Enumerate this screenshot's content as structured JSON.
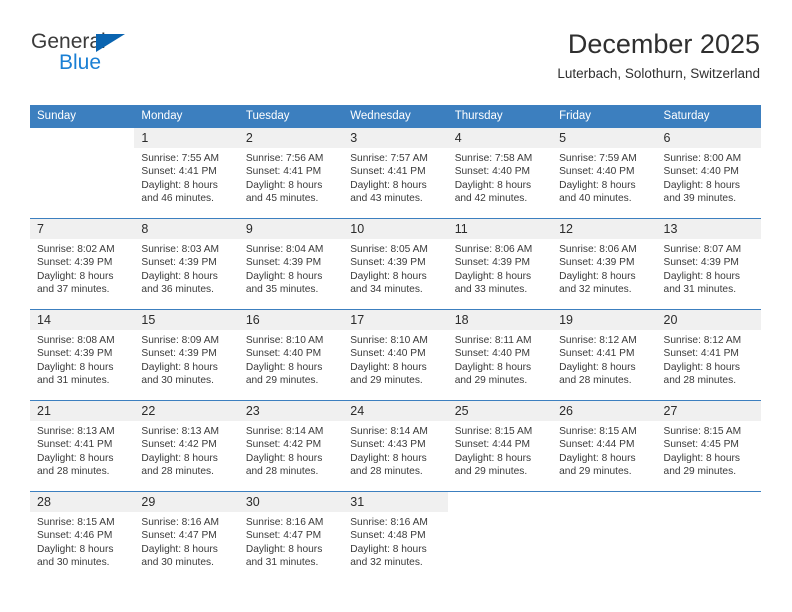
{
  "brand": {
    "name_top": "General",
    "name_bottom": "Blue",
    "triangle_color": "#0a64b0",
    "blue_color": "#1a7fd4"
  },
  "header": {
    "title": "December 2025",
    "subtitle": "Luterbach, Solothurn, Switzerland"
  },
  "theme": {
    "header_row_bg": "#3c7fbf",
    "header_row_text": "#ffffff",
    "daynum_bg": "#f0f0f0",
    "grid_line": "#3c7fbf"
  },
  "weekday_headers": [
    "Sunday",
    "Monday",
    "Tuesday",
    "Wednesday",
    "Thursday",
    "Friday",
    "Saturday"
  ],
  "weeks": [
    [
      {
        "day": "",
        "sunrise": "",
        "sunset": "",
        "daylight1": "",
        "daylight2": ""
      },
      {
        "day": "1",
        "sunrise": "Sunrise: 7:55 AM",
        "sunset": "Sunset: 4:41 PM",
        "daylight1": "Daylight: 8 hours",
        "daylight2": "and 46 minutes."
      },
      {
        "day": "2",
        "sunrise": "Sunrise: 7:56 AM",
        "sunset": "Sunset: 4:41 PM",
        "daylight1": "Daylight: 8 hours",
        "daylight2": "and 45 minutes."
      },
      {
        "day": "3",
        "sunrise": "Sunrise: 7:57 AM",
        "sunset": "Sunset: 4:41 PM",
        "daylight1": "Daylight: 8 hours",
        "daylight2": "and 43 minutes."
      },
      {
        "day": "4",
        "sunrise": "Sunrise: 7:58 AM",
        "sunset": "Sunset: 4:40 PM",
        "daylight1": "Daylight: 8 hours",
        "daylight2": "and 42 minutes."
      },
      {
        "day": "5",
        "sunrise": "Sunrise: 7:59 AM",
        "sunset": "Sunset: 4:40 PM",
        "daylight1": "Daylight: 8 hours",
        "daylight2": "and 40 minutes."
      },
      {
        "day": "6",
        "sunrise": "Sunrise: 8:00 AM",
        "sunset": "Sunset: 4:40 PM",
        "daylight1": "Daylight: 8 hours",
        "daylight2": "and 39 minutes."
      }
    ],
    [
      {
        "day": "7",
        "sunrise": "Sunrise: 8:02 AM",
        "sunset": "Sunset: 4:39 PM",
        "daylight1": "Daylight: 8 hours",
        "daylight2": "and 37 minutes."
      },
      {
        "day": "8",
        "sunrise": "Sunrise: 8:03 AM",
        "sunset": "Sunset: 4:39 PM",
        "daylight1": "Daylight: 8 hours",
        "daylight2": "and 36 minutes."
      },
      {
        "day": "9",
        "sunrise": "Sunrise: 8:04 AM",
        "sunset": "Sunset: 4:39 PM",
        "daylight1": "Daylight: 8 hours",
        "daylight2": "and 35 minutes."
      },
      {
        "day": "10",
        "sunrise": "Sunrise: 8:05 AM",
        "sunset": "Sunset: 4:39 PM",
        "daylight1": "Daylight: 8 hours",
        "daylight2": "and 34 minutes."
      },
      {
        "day": "11",
        "sunrise": "Sunrise: 8:06 AM",
        "sunset": "Sunset: 4:39 PM",
        "daylight1": "Daylight: 8 hours",
        "daylight2": "and 33 minutes."
      },
      {
        "day": "12",
        "sunrise": "Sunrise: 8:06 AM",
        "sunset": "Sunset: 4:39 PM",
        "daylight1": "Daylight: 8 hours",
        "daylight2": "and 32 minutes."
      },
      {
        "day": "13",
        "sunrise": "Sunrise: 8:07 AM",
        "sunset": "Sunset: 4:39 PM",
        "daylight1": "Daylight: 8 hours",
        "daylight2": "and 31 minutes."
      }
    ],
    [
      {
        "day": "14",
        "sunrise": "Sunrise: 8:08 AM",
        "sunset": "Sunset: 4:39 PM",
        "daylight1": "Daylight: 8 hours",
        "daylight2": "and 31 minutes."
      },
      {
        "day": "15",
        "sunrise": "Sunrise: 8:09 AM",
        "sunset": "Sunset: 4:39 PM",
        "daylight1": "Daylight: 8 hours",
        "daylight2": "and 30 minutes."
      },
      {
        "day": "16",
        "sunrise": "Sunrise: 8:10 AM",
        "sunset": "Sunset: 4:40 PM",
        "daylight1": "Daylight: 8 hours",
        "daylight2": "and 29 minutes."
      },
      {
        "day": "17",
        "sunrise": "Sunrise: 8:10 AM",
        "sunset": "Sunset: 4:40 PM",
        "daylight1": "Daylight: 8 hours",
        "daylight2": "and 29 minutes."
      },
      {
        "day": "18",
        "sunrise": "Sunrise: 8:11 AM",
        "sunset": "Sunset: 4:40 PM",
        "daylight1": "Daylight: 8 hours",
        "daylight2": "and 29 minutes."
      },
      {
        "day": "19",
        "sunrise": "Sunrise: 8:12 AM",
        "sunset": "Sunset: 4:41 PM",
        "daylight1": "Daylight: 8 hours",
        "daylight2": "and 28 minutes."
      },
      {
        "day": "20",
        "sunrise": "Sunrise: 8:12 AM",
        "sunset": "Sunset: 4:41 PM",
        "daylight1": "Daylight: 8 hours",
        "daylight2": "and 28 minutes."
      }
    ],
    [
      {
        "day": "21",
        "sunrise": "Sunrise: 8:13 AM",
        "sunset": "Sunset: 4:41 PM",
        "daylight1": "Daylight: 8 hours",
        "daylight2": "and 28 minutes."
      },
      {
        "day": "22",
        "sunrise": "Sunrise: 8:13 AM",
        "sunset": "Sunset: 4:42 PM",
        "daylight1": "Daylight: 8 hours",
        "daylight2": "and 28 minutes."
      },
      {
        "day": "23",
        "sunrise": "Sunrise: 8:14 AM",
        "sunset": "Sunset: 4:42 PM",
        "daylight1": "Daylight: 8 hours",
        "daylight2": "and 28 minutes."
      },
      {
        "day": "24",
        "sunrise": "Sunrise: 8:14 AM",
        "sunset": "Sunset: 4:43 PM",
        "daylight1": "Daylight: 8 hours",
        "daylight2": "and 28 minutes."
      },
      {
        "day": "25",
        "sunrise": "Sunrise: 8:15 AM",
        "sunset": "Sunset: 4:44 PM",
        "daylight1": "Daylight: 8 hours",
        "daylight2": "and 29 minutes."
      },
      {
        "day": "26",
        "sunrise": "Sunrise: 8:15 AM",
        "sunset": "Sunset: 4:44 PM",
        "daylight1": "Daylight: 8 hours",
        "daylight2": "and 29 minutes."
      },
      {
        "day": "27",
        "sunrise": "Sunrise: 8:15 AM",
        "sunset": "Sunset: 4:45 PM",
        "daylight1": "Daylight: 8 hours",
        "daylight2": "and 29 minutes."
      }
    ],
    [
      {
        "day": "28",
        "sunrise": "Sunrise: 8:15 AM",
        "sunset": "Sunset: 4:46 PM",
        "daylight1": "Daylight: 8 hours",
        "daylight2": "and 30 minutes."
      },
      {
        "day": "29",
        "sunrise": "Sunrise: 8:16 AM",
        "sunset": "Sunset: 4:47 PM",
        "daylight1": "Daylight: 8 hours",
        "daylight2": "and 30 minutes."
      },
      {
        "day": "30",
        "sunrise": "Sunrise: 8:16 AM",
        "sunset": "Sunset: 4:47 PM",
        "daylight1": "Daylight: 8 hours",
        "daylight2": "and 31 minutes."
      },
      {
        "day": "31",
        "sunrise": "Sunrise: 8:16 AM",
        "sunset": "Sunset: 4:48 PM",
        "daylight1": "Daylight: 8 hours",
        "daylight2": "and 32 minutes."
      },
      {
        "day": "",
        "sunrise": "",
        "sunset": "",
        "daylight1": "",
        "daylight2": ""
      },
      {
        "day": "",
        "sunrise": "",
        "sunset": "",
        "daylight1": "",
        "daylight2": ""
      },
      {
        "day": "",
        "sunrise": "",
        "sunset": "",
        "daylight1": "",
        "daylight2": ""
      }
    ]
  ]
}
